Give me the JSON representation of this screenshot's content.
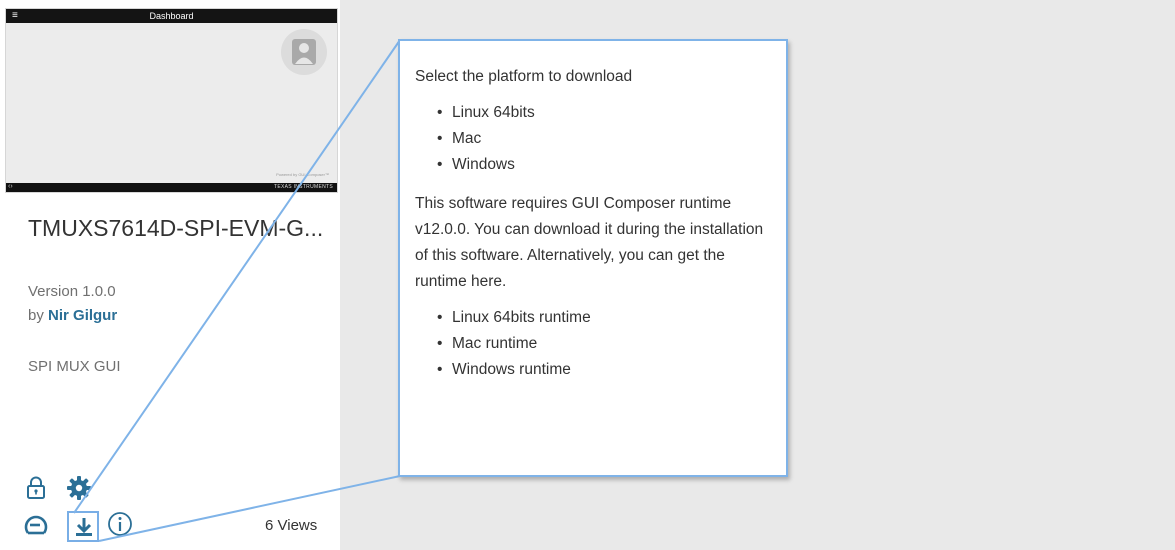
{
  "thumbnail": {
    "title": "Dashboard",
    "menu_glyph": "≡",
    "nav_glyph": "‹›",
    "brand_text": "TEXAS INSTRUMENTS",
    "footnote": "Powered by GUI Composer™"
  },
  "app": {
    "name": "TMUXS7614D-SPI-EVM-G...",
    "version": "Version 1.0.0",
    "author_prefix": "by ",
    "author": "Nir Gilgur",
    "description": "SPI MUX GUI",
    "views": "6 Views"
  },
  "icons": {
    "lock": "lock-icon",
    "settings": "gear-icon",
    "launch": "launch-icon",
    "download": "download-icon",
    "info": "info-icon"
  },
  "popup": {
    "heading": "Select the platform to download",
    "platforms": [
      "Linux 64bits",
      "Mac",
      "Windows"
    ],
    "note": "This software requires GUI Composer runtime v12.0.0. You can download it during the installation of this software. Alternatively, you can get the runtime here.",
    "runtimes": [
      "Linux 64bits runtime",
      "Mac runtime",
      "Windows runtime"
    ]
  },
  "colors": {
    "link": "#2b6f96",
    "highlight": "#7fb3e8",
    "panel_bg": "#e9e9e9",
    "icon": "#2b6f96"
  }
}
